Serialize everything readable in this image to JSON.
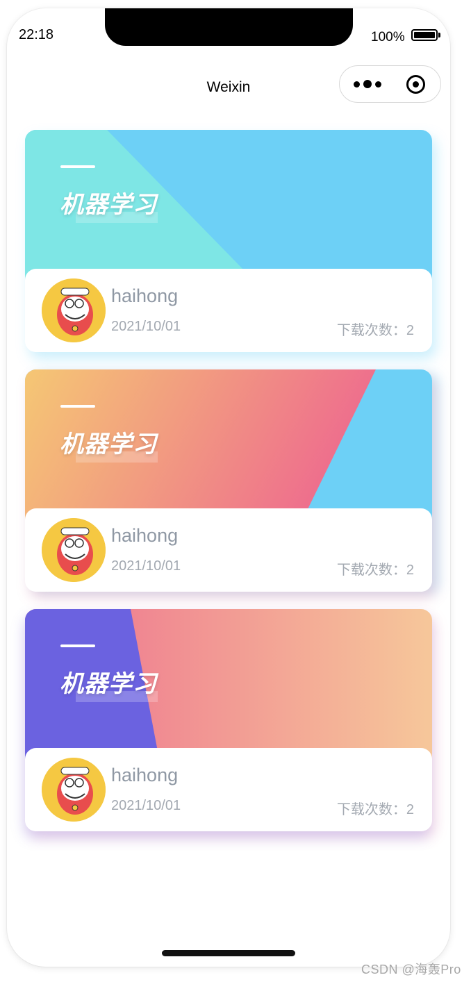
{
  "status_bar": {
    "time": "22:18",
    "battery_percent": "100%"
  },
  "nav": {
    "title": "Weixin"
  },
  "cards": [
    {
      "title": "机器学习",
      "user": "haihong",
      "date": "2021/10/01",
      "downloads": "下载次数：2",
      "colors": {
        "left": "#7ee6e5",
        "right": "#6dd0f6"
      }
    },
    {
      "title": "机器学习",
      "user": "haihong",
      "date": "2021/10/01",
      "downloads": "下载次数：2",
      "colors": {
        "left": "#f5c774",
        "mid": "#ef6b8e",
        "right": "#6dd0f6"
      }
    },
    {
      "title": "机器学习",
      "user": "haihong",
      "date": "2021/10/01",
      "downloads": "下载次数：2",
      "colors": {
        "left": "#6b62e0",
        "mid": "#ee6f8e",
        "right": "#f6c79a"
      }
    }
  ],
  "watermark": "CSDN @海轰Pro"
}
